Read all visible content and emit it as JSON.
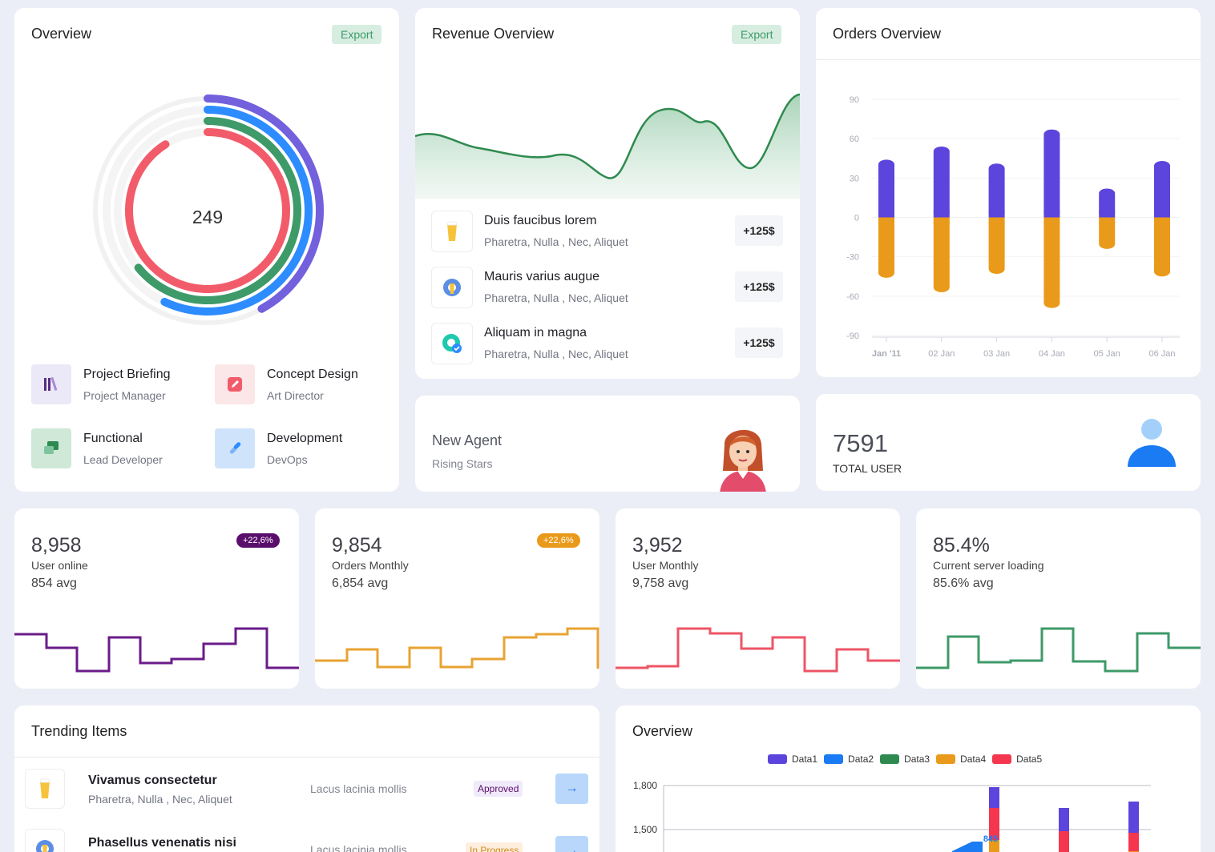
{
  "overview": {
    "title": "Overview",
    "export_label": "Export",
    "center_value": "249",
    "items": [
      {
        "title": "Project Briefing",
        "subtitle": "Project Manager",
        "icon": "books-icon"
      },
      {
        "title": "Concept Design",
        "subtitle": "Art Director",
        "icon": "edit-icon"
      },
      {
        "title": "Functional",
        "subtitle": "Lead Developer",
        "icon": "chat-icon"
      },
      {
        "title": "Development",
        "subtitle": "DevOps",
        "icon": "link-icon"
      }
    ],
    "radial_data": {
      "type": "radialBar",
      "series": [
        {
          "color": "#7360dc",
          "value": 0.42
        },
        {
          "color": "#2d8cff",
          "value": 0.57
        },
        {
          "color": "#3e9a68",
          "value": 0.64
        },
        {
          "color": "#f25c6a",
          "value": 0.91
        }
      ]
    }
  },
  "revenue": {
    "title": "Revenue Overview",
    "export_label": "Export",
    "line_color": "#2f8a4f",
    "items": [
      {
        "title": "Duis faucibus lorem",
        "subtitle": "Pharetra, Nulla , Nec, Aliquet",
        "value": "+125$",
        "icon": "beer-icon"
      },
      {
        "title": "Mauris varius augue",
        "subtitle": "Pharetra, Nulla , Nec, Aliquet",
        "value": "+125$",
        "icon": "gear-wrench-icon"
      },
      {
        "title": "Aliquam in magna",
        "subtitle": "Pharetra, Nulla , Nec, Aliquet",
        "value": "+125$",
        "icon": "gear-check-icon"
      }
    ]
  },
  "orders": {
    "title": "Orders Overview",
    "chart_data": {
      "type": "bar",
      "categories": [
        "Jan '11",
        "02 Jan",
        "03 Jan",
        "04 Jan",
        "05 Jan",
        "06 Jan"
      ],
      "y_ticks": [
        90,
        60,
        30,
        0,
        -30,
        -60,
        -90
      ],
      "ylim": [
        -90,
        90
      ],
      "series": [
        {
          "values": [
            44,
            54,
            41,
            67,
            22,
            43
          ],
          "color": "#5b45dc"
        },
        {
          "values": [
            -46,
            -57,
            -43,
            -69,
            -24,
            -45
          ],
          "color": "#ea9a1a"
        }
      ]
    }
  },
  "agent": {
    "title": "New Agent",
    "subtitle": "Rising Stars"
  },
  "total_user": {
    "value": "7591",
    "label": "TOTAL USER",
    "icon": "user-icon"
  },
  "stats": [
    {
      "value": "8,958",
      "label": "User online",
      "avg": "854 avg",
      "badge": "+22,6%",
      "badge_color": "#5a0e6b",
      "line_color": "#6a1b8a"
    },
    {
      "value": "9,854",
      "label": "Orders Monthly",
      "avg": "6,854 avg",
      "badge": "+22,6%",
      "badge_color": "#ea9a1a",
      "line_color": "#e8a332"
    },
    {
      "value": "3,952",
      "label": "User Monthly",
      "avg": "9,758 avg",
      "badge": "",
      "badge_color": "",
      "line_color": "#ee5566"
    },
    {
      "value": "85.4%",
      "label": "Current server loading",
      "avg": "85.6% avg",
      "badge": "",
      "badge_color": "",
      "line_color": "#3e9a68"
    }
  ],
  "trending": {
    "title": "Trending Items",
    "items": [
      {
        "title": "Vivamus consectetur",
        "subtitle": "Pharetra, Nulla , Nec, Aliquet",
        "desc": "Lacus lacinia mollis",
        "status": "Approved",
        "icon": "beer-icon"
      },
      {
        "title": "Phasellus venenatis nisi",
        "subtitle": "",
        "desc": "Lacus lacinia mollis",
        "status": "In Progress",
        "icon": "gear-wrench-icon"
      }
    ]
  },
  "overview2": {
    "title": "Overview",
    "chart_data": {
      "type": "bar",
      "stacked": true,
      "legend": [
        "Data1",
        "Data2",
        "Data3",
        "Data4",
        "Data5"
      ],
      "legend_colors": [
        "#5b45dc",
        "#1a7bf2",
        "#2f8a4f",
        "#ea9a1a",
        "#f5364f"
      ],
      "y_ticks": [
        "1,800",
        "1,500"
      ],
      "annotation": "845"
    }
  }
}
